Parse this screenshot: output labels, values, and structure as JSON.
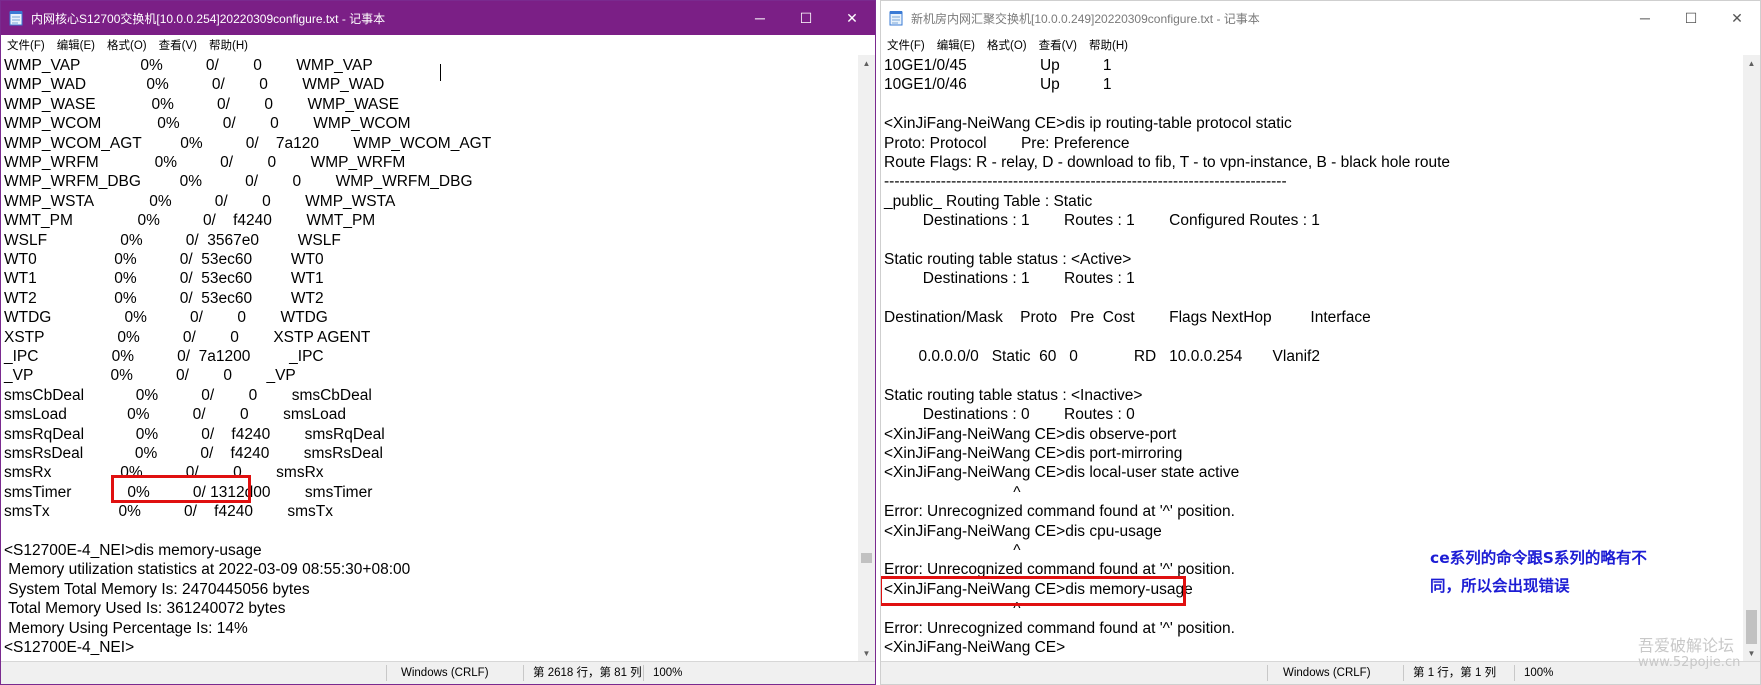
{
  "left_window": {
    "title": "内网核心S12700交换机[10.0.0.254]20220309configure.txt - 记事本",
    "menu": [
      "文件(F)",
      "编辑(E)",
      "格式(O)",
      "查看(V)",
      "帮助(H)"
    ],
    "lines": [
      "WMP_VAP              0%          0/        0        WMP_VAP",
      "WMP_WAD              0%          0/        0        WMP_WAD",
      "WMP_WASE             0%          0/        0        WMP_WASE",
      "WMP_WCOM             0%          0/        0        WMP_WCOM",
      "WMP_WCOM_AGT         0%          0/    7a120        WMP_WCOM_AGT",
      "WMP_WRFM             0%          0/        0        WMP_WRFM",
      "WMP_WRFM_DBG         0%          0/        0        WMP_WRFM_DBG",
      "WMP_WSTA             0%          0/        0        WMP_WSTA",
      "WMT_PM               0%          0/    f4240        WMT_PM",
      "WSLF                 0%          0/  3567e0         WSLF",
      "WT0                  0%          0/  53ec60         WT0",
      "WT1                  0%          0/  53ec60         WT1",
      "WT2                  0%          0/  53ec60         WT2",
      "WTDG                 0%          0/        0        WTDG",
      "XSTP                 0%          0/        0        XSTP AGENT",
      "_IPC                 0%          0/  7a1200         _IPC",
      "_VP                  0%          0/        0        _VP",
      "smsCbDeal            0%          0/        0        smsCbDeal",
      "smsLoad              0%          0/        0        smsLoad",
      "smsRqDeal            0%          0/    f4240        smsRqDeal",
      "smsRsDeal            0%          0/    f4240        smsRsDeal",
      "smsRx                0%          0/        0        smsRx",
      "smsTimer             0%          0/ 1312d00        smsTimer",
      "smsTx                0%          0/    f4240        smsTx",
      "",
      "<S12700E-4_NEI>dis memory-usage",
      " Memory utilization statistics at 2022-03-09 08:55:30+08:00",
      " System Total Memory Is: 2470445056 bytes",
      " Total Memory Used Is: 361240072 bytes",
      " Memory Using Percentage Is: 14%",
      "<S12700E-4_NEI>"
    ],
    "status": {
      "encoding": "Windows (CRLF)",
      "position": "第 2618 行，第 81 列",
      "zoom": "100%"
    }
  },
  "right_window": {
    "title": "新机房内网汇聚交换机[10.0.0.249]20220309configure.txt - 记事本",
    "menu": [
      "文件(F)",
      "编辑(E)",
      "格式(O)",
      "查看(V)",
      "帮助(H)"
    ],
    "lines": [
      "10GE1/0/45                 Up          1",
      "10GE1/0/46                 Up          1",
      "",
      "<XinJiFang-NeiWang CE>dis ip routing-table protocol static",
      "Proto: Protocol        Pre: Preference",
      "Route Flags: R - relay, D - download to fib, T - to vpn-instance, B - black hole route",
      "------------------------------------------------------------------------------",
      "_public_ Routing Table : Static",
      "         Destinations : 1        Routes : 1        Configured Routes : 1",
      "",
      "Static routing table status : <Active>",
      "         Destinations : 1        Routes : 1",
      "",
      "Destination/Mask    Proto   Pre  Cost        Flags NextHop         Interface",
      "",
      "        0.0.0.0/0   Static  60   0             RD   10.0.0.254       Vlanif2",
      "",
      "Static routing table status : <Inactive>",
      "         Destinations : 0        Routes : 0",
      "<XinJiFang-NeiWang CE>dis observe-port",
      "<XinJiFang-NeiWang CE>dis port-mirroring",
      "<XinJiFang-NeiWang CE>dis local-user state active",
      "                              ^",
      "Error: Unrecognized command found at '^' position.",
      "<XinJiFang-NeiWang CE>dis cpu-usage",
      "                              ^",
      "Error: Unrecognized command found at '^' position.",
      "<XinJiFang-NeiWang CE>dis memory-usage",
      "                              ^",
      "Error: Unrecognized command found at '^' position.",
      "<XinJiFang-NeiWang CE>"
    ],
    "status": {
      "encoding": "Windows (CRLF)",
      "position": "第 1 行，第 1 列",
      "zoom": "100%"
    }
  },
  "annotation": "ce系列的命令跟S系列的略有不\n同，所以会出现错误",
  "watermark": {
    "line1": "吾爱破解论坛",
    "line2": "www.52pojie.cn"
  },
  "controls": {
    "minimize": "─",
    "maximize": "☐",
    "close": "✕"
  },
  "colors": {
    "left_titlebar": "#7b1f86",
    "highlight_box": "#e01010",
    "annotation": "#1c1cd4"
  }
}
